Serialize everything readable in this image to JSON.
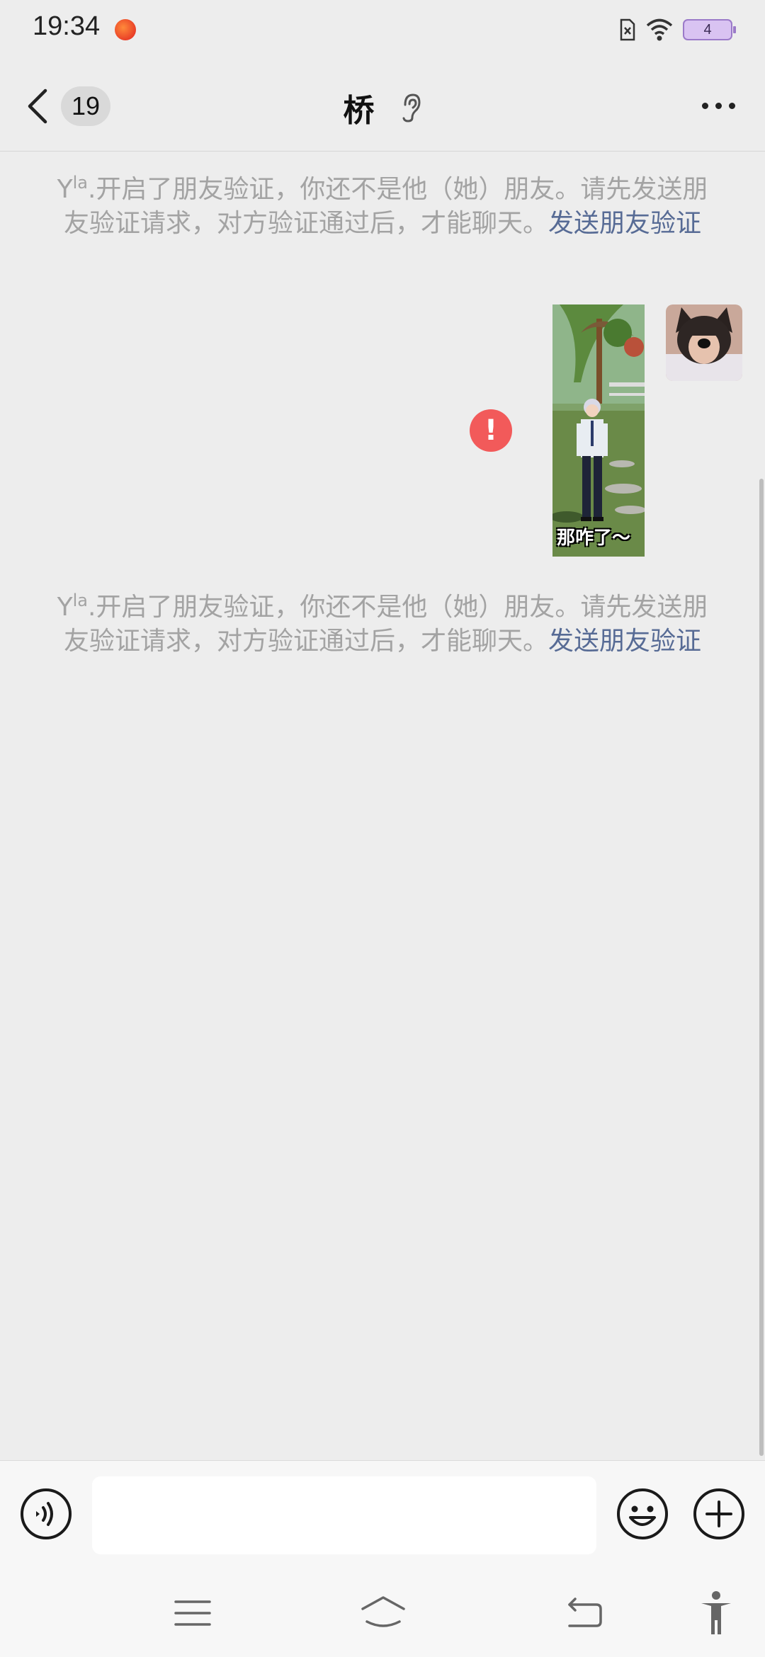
{
  "status_bar": {
    "time": "19:34",
    "battery_level": "4",
    "icons": [
      "app-notification-icon",
      "no-sim-icon",
      "wifi-icon",
      "battery-icon"
    ]
  },
  "header": {
    "back_icon": "chevron-left-icon",
    "unread_count": "19",
    "title": "桥",
    "title_icon": "ear-icon",
    "more_icon": "more-dots-icon"
  },
  "messages": [
    {
      "type": "system",
      "name_main": "Y",
      "name_sup": "la",
      "text": ".开启了朋友验证，你还不是他（她）朋友。请先发送朋友验证请求，对方验证通过后，才能聊天。",
      "link": "发送朋友验证"
    },
    {
      "type": "sticker",
      "direction": "outgoing",
      "caption": "那咋了～",
      "status": "send-failed",
      "status_icon": "exclamation-icon",
      "status_glyph": "!"
    },
    {
      "type": "system",
      "name_main": "Y",
      "name_sup": "la",
      "text": ".开启了朋友验证，你还不是他（她）朋友。请先发送朋友验证请求，对方验证通过后，才能聊天。",
      "link": "发送朋友验证"
    }
  ],
  "input_bar": {
    "voice_icon": "voice-icon",
    "input_value": "",
    "emoji_icon": "emoji-icon",
    "plus_icon": "plus-circle-icon"
  },
  "nav_bar": {
    "icons": [
      "menu-icon",
      "home-icon",
      "back-arrow-icon",
      "accessibility-icon"
    ]
  },
  "colors": {
    "background": "#ededed",
    "link": "#576b95",
    "system_text": "#a3a3a3",
    "error": "#f25a5a",
    "battery": "#d9c3f2"
  }
}
